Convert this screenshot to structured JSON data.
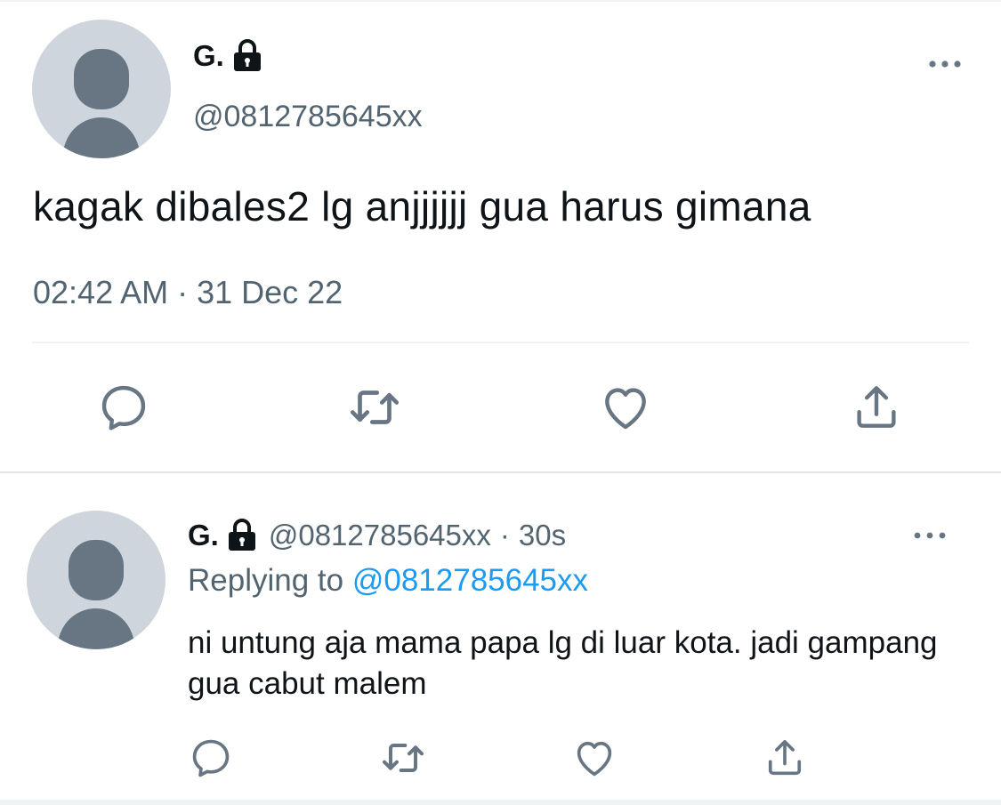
{
  "main_tweet": {
    "display_name": "G.",
    "handle": "@0812785645xx",
    "text": "kagak dibales2 lg anjjjjjj gua harus gimana",
    "timestamp": "02:42 AM · 31 Dec 22",
    "icons": {
      "lock": "lock-icon",
      "more": "more-icon",
      "reply": "reply-icon",
      "retweet": "retweet-icon",
      "like": "like-icon",
      "share": "share-icon"
    }
  },
  "reply_tweet": {
    "display_name": "G.",
    "handle": "@0812785645xx",
    "separator": "·",
    "age": "30s",
    "replying_prefix": "Replying to",
    "replying_to": "@0812785645xx",
    "text": "ni untung aja mama papa lg di luar kota. jadi gampang gua cabut malem"
  },
  "colors": {
    "text_primary": "#0f1419",
    "text_secondary": "#536471",
    "link": "#1d9bf0",
    "avatar_bg": "#ced5dc",
    "avatar_figure": "#687684",
    "icon": "#687684"
  }
}
